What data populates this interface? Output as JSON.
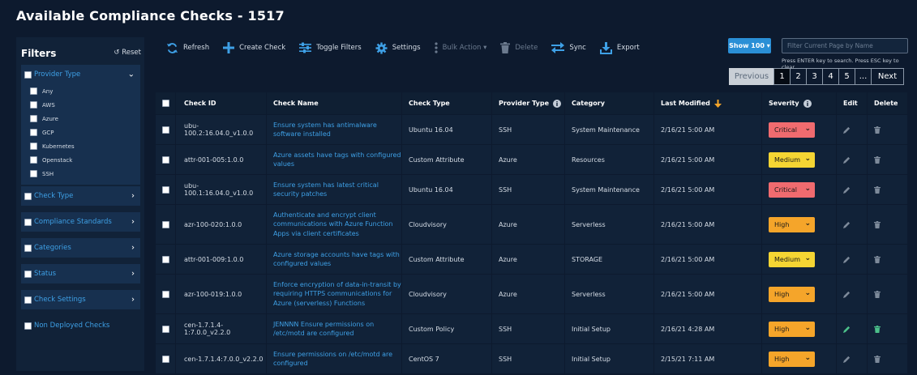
{
  "title": "Available Compliance Checks - 1517",
  "sidebar": {
    "heading": "Filters",
    "reset": "↺ Reset",
    "provider": {
      "label": "Provider Type",
      "options": [
        "Any",
        "AWS",
        "Azure",
        "GCP",
        "Kubernetes",
        "Openstack",
        "SSH"
      ]
    },
    "groups": [
      "Check Type",
      "Compliance Standards",
      "Categories",
      "Status",
      "Check Settings"
    ],
    "non_deployed": "Non Deployed Checks"
  },
  "toolbar": {
    "refresh": "Refresh",
    "create": "Create Check",
    "toggle": "Toggle Filters",
    "settings": "Settings",
    "bulk": "Bulk Action ▾",
    "delete": "Delete",
    "sync": "Sync",
    "export": "Export"
  },
  "show": "Show 100 ▾",
  "search": {
    "placeholder": "Filter Current Page by Name",
    "hint": "Press ENTER key to search. Press ESC key to clear"
  },
  "pagination": {
    "previous": "Previous",
    "pages": [
      "1",
      "2",
      "3",
      "4",
      "5",
      "..."
    ],
    "next": "Next"
  },
  "columns": {
    "id": "Check ID",
    "name": "Check Name",
    "type": "Check Type",
    "provider": "Provider Type",
    "category": "Category",
    "modified": "Last Modified",
    "severity": "Severity",
    "edit": "Edit",
    "delete": "Delete"
  },
  "rows": [
    {
      "id": "ubu-100.2:16.04.0_v1.0.0",
      "name": "Ensure system has antimalware software installed",
      "type": "Ubuntu 16.04",
      "provider": "SSH",
      "category": "System Maintenance",
      "modified": "2/16/21 5:00 AM",
      "severity": "Critical",
      "sev_class": "critical",
      "h": 37,
      "active": false
    },
    {
      "id": "attr-001-005:1.0.0",
      "name": "Azure assets have tags with configured values",
      "type": "Custom Attribute",
      "provider": "Azure",
      "category": "Resources",
      "modified": "2/16/21 5:00 AM",
      "severity": "Medium",
      "sev_class": "medium",
      "h": 37,
      "active": false
    },
    {
      "id": "ubu-100.1:16.04.0_v1.0.0",
      "name": "Ensure system has latest critical security patches",
      "type": "Ubuntu 16.04",
      "provider": "SSH",
      "category": "System Maintenance",
      "modified": "2/16/21 5:00 AM",
      "severity": "Critical",
      "sev_class": "critical",
      "h": 37,
      "active": false
    },
    {
      "id": "azr-100-020:1.0.0",
      "name": "Authenticate and encrypt client communications with Azure Function Apps via client certificates",
      "type": "Cloudvisory",
      "provider": "Azure",
      "category": "Serverless",
      "modified": "2/16/21 5:00 AM",
      "severity": "High",
      "sev_class": "high",
      "h": 49,
      "active": false
    },
    {
      "id": "attr-001-009:1.0.0",
      "name": "Azure storage accounts have tags with configured values",
      "type": "Custom Attribute",
      "provider": "Azure",
      "category": "STORAGE",
      "modified": "2/16/21 5:00 AM",
      "severity": "Medium",
      "sev_class": "medium",
      "h": 37,
      "active": false
    },
    {
      "id": "azr-100-019:1.0.0",
      "name": "Enforce encryption of data-in-transit by requiring HTTPS communications for Azure (serverless) Functions",
      "type": "Cloudvisory",
      "provider": "Azure",
      "category": "Serverless",
      "modified": "2/16/21 5:00 AM",
      "severity": "High",
      "sev_class": "high",
      "h": 49,
      "active": false
    },
    {
      "id": "cen-1.7.1.4-1:7.0.0_v2.2.0",
      "name": "JENNNN Ensure permissions on /etc/motd are configured",
      "type": "Custom Policy",
      "provider": "SSH",
      "category": "Initial Setup",
      "modified": "2/16/21 4:28 AM",
      "severity": "High",
      "sev_class": "high",
      "h": 37,
      "active": true
    },
    {
      "id": "cen-1.7.1.4:7.0.0_v2.2.0",
      "name": "Ensure permissions on /etc/motd are configured",
      "type": "CentOS 7",
      "provider": "SSH",
      "category": "Initial Setup",
      "modified": "2/15/21 7:11 AM",
      "severity": "High",
      "sev_class": "high",
      "h": 37,
      "active": false
    }
  ],
  "colors": {
    "background": "#0d1a2e",
    "link": "#3ea0e6",
    "critical": "#f06b6f",
    "medium": "#f5d533",
    "high": "#f5a52a",
    "active_action": "#4cc08a"
  }
}
